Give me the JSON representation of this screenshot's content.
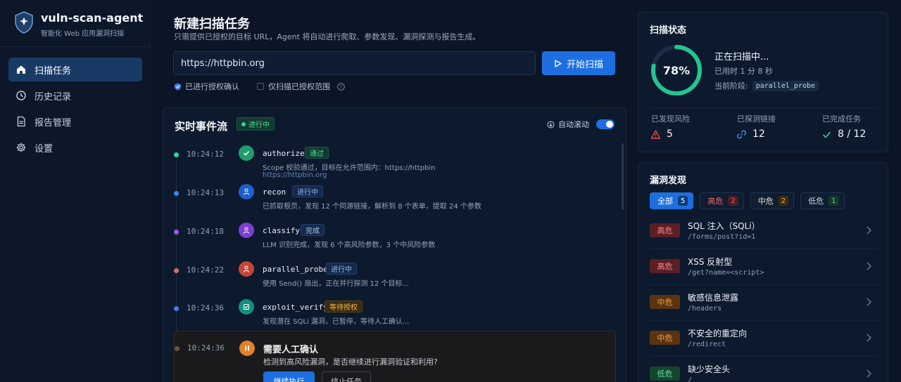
{
  "brand": {
    "title": "vuln-scan-agent",
    "subtitle": "智能化 Web 应用漏洞扫描"
  },
  "nav": [
    {
      "label": "扫描任务",
      "icon": "home-icon",
      "active": true
    },
    {
      "label": "历史记录",
      "icon": "clock-icon",
      "active": false
    },
    {
      "label": "报告管理",
      "icon": "document-icon",
      "active": false
    },
    {
      "label": "设置",
      "icon": "gear-icon",
      "active": false
    }
  ],
  "new_scan": {
    "title": "新建扫描任务",
    "subtitle": "只需提供已授权的目标 URL，Agent 将自动进行爬取、参数发现、漏洞探测与报告生成。",
    "url_value": "https://httpbin.org",
    "start_label": "开始扫描",
    "option_authorized": "已进行授权确认",
    "option_scope_only": "仅扫描已授权范围"
  },
  "stream": {
    "title": "实时事件流",
    "status": "进行中",
    "autoscroll_label": "自动滚动",
    "events": [
      {
        "time": "10:24:12",
        "name": "authorize",
        "badge": "通过",
        "desc": "Scope 校验通过，目标在允许范围内：https://httpbin",
        "desc2": "https://httpbin.org",
        "color": "#34d399"
      },
      {
        "time": "10:24:13",
        "name": "recon",
        "badge": "进行中",
        "desc": "已抓取根页，发现 12 个同源链接，解析到 8 个表单，提取 24 个参数",
        "color": "#3b82f6"
      },
      {
        "time": "10:24:18",
        "name": "classify",
        "badge": "完成",
        "desc": "LLM 识别完成，发现 6 个高风险参数，3 个中风险参数",
        "color": "#a855f7"
      },
      {
        "time": "10:24:22",
        "name": "parallel_probe",
        "badge": "进行中",
        "desc": "使用 Send() 扇出，正在并行探测 12 个目标...",
        "color": "#ef4444"
      },
      {
        "time": "10:24:36",
        "name": "exploit_verify",
        "badge": "等待授权",
        "desc": "发现潜在 SQLi 漏洞，已暂停，等待人工确认...",
        "color": "#14b8a6"
      }
    ],
    "confirm": {
      "time": "10:24:36",
      "title": "需要人工确认",
      "desc": "检测到高风险漏洞，是否继续进行漏洞验证和利用?",
      "continue_label": "继续执行",
      "stop_label": "终止任务"
    }
  },
  "status": {
    "title": "扫描状态",
    "progress_percent": 78,
    "progress_label": "78%",
    "state": "正在扫描中...",
    "elapsed": "已用时 1 分 8 秒",
    "phase_label": "当前阶段:",
    "phase_value": "parallel_probe",
    "stats": [
      {
        "label": "已发现风险",
        "value": "5",
        "icon": "warning-icon"
      },
      {
        "label": "已探测链接",
        "value": "12",
        "icon": "link-icon"
      },
      {
        "label": "已完成任务",
        "value": "8 / 12",
        "icon": "check-icon"
      }
    ]
  },
  "vulns": {
    "title": "漏洞发现",
    "filters": [
      {
        "label": "全部",
        "count": "5"
      },
      {
        "label": "高危",
        "count": "2"
      },
      {
        "label": "中危",
        "count": "2"
      },
      {
        "label": "低危",
        "count": "1"
      }
    ],
    "items": [
      {
        "severity": "高危",
        "title": "SQL 注入（SQLi）",
        "path": "/forms/post?id=1"
      },
      {
        "severity": "高危",
        "title": "XSS 反射型",
        "path": "/get?name=<script>"
      },
      {
        "severity": "中危",
        "title": "敏感信息泄露",
        "path": "/headers"
      },
      {
        "severity": "中危",
        "title": "不安全的重定向",
        "path": "/redirect"
      },
      {
        "severity": "低危",
        "title": "缺少安全头",
        "path": "/"
      }
    ]
  },
  "colors": {
    "accent": "#1d6fe0",
    "background": "#0b1526",
    "success": "#34d399",
    "high": "#ef4444",
    "medium": "#f59e0b",
    "low": "#22c55e"
  }
}
